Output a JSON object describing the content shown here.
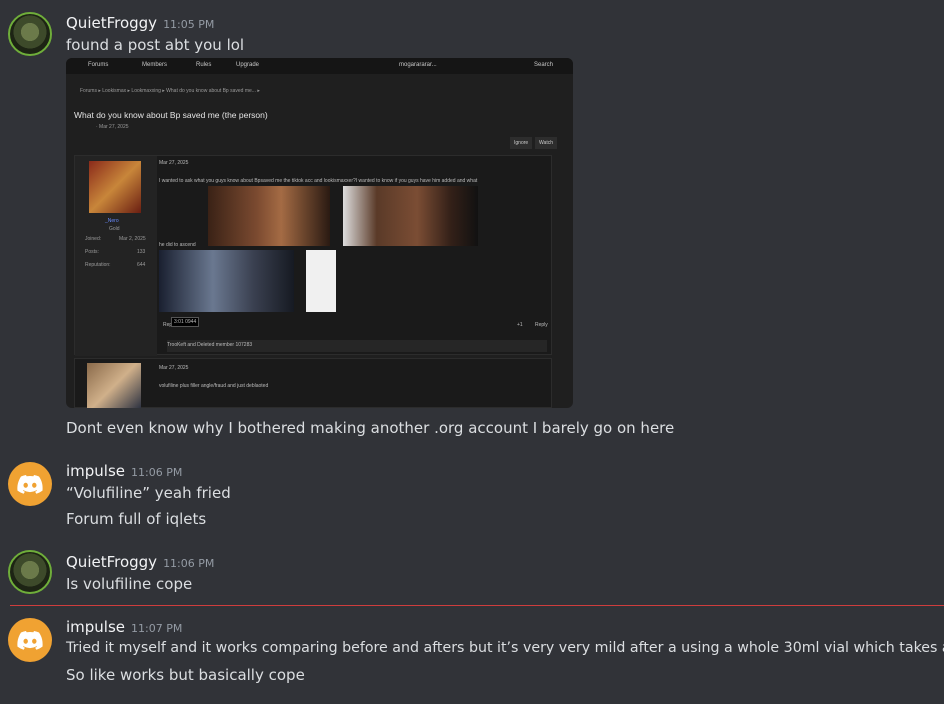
{
  "messages": [
    {
      "username": "QuietFroggy",
      "time": "11:05 PM",
      "lines": [
        "found a post abt you lol"
      ],
      "after_embed": "Dont even know why I bothered making another .org account I barely go on here"
    },
    {
      "username": "impulse",
      "time": "11:06 PM",
      "lines": [
        "“Volufiline” yeah fried",
        "Forum full of iqlets"
      ]
    },
    {
      "username": "QuietFroggy",
      "time": "11:06 PM",
      "lines": [
        "Is volufiline cope"
      ]
    },
    {
      "username": "impulse",
      "time": "11:07 PM",
      "lines": [
        "Tried it myself and it works comparing before and afters but it’s very very mild after a using a whole 30ml vial which takes ages",
        "So like works but basically cope"
      ]
    }
  ],
  "embed": {
    "nav": {
      "forums": "Forums",
      "members": "Members",
      "rules": "Rules",
      "upgrade": "Upgrade",
      "user": "mogarararar...",
      "search": "Search"
    },
    "breadcrumb": "Forums  ▸ Lookismax  ▸ Lookmaxxing  ▸ What do you know about Bp saved me...  ▸",
    "title": "What do you know about Bp saved me (the person)",
    "meta": "· Mar 27, 2025",
    "ignore": "Ignore",
    "watch": "Watch",
    "post_date": "Mar 27, 2025",
    "post_text": "I wanted to ask what you guys know about Bpsaved me the tiktok acc and lookismaxxer?I wanted to know if you guys have him added and what",
    "post_text2": "he did to ascend",
    "user_name": "_Nero",
    "user_rank": "Gold",
    "stats": [
      {
        "label": "Joined:",
        "value": "Mar 2, 2025"
      },
      {
        "label": "Posts:",
        "value": "133"
      },
      {
        "label": "Reputation:",
        "value": "644"
      }
    ],
    "report": "Report",
    "reactions": "TrooKeft and Deleted member 107283",
    "reply": "Reply",
    "likes": "+1",
    "post2_date": "Mar 27, 2025",
    "post2_text": "volufiline plus filler angle/fraud and just deblaoted",
    "tooltip": "3:01 0944"
  }
}
